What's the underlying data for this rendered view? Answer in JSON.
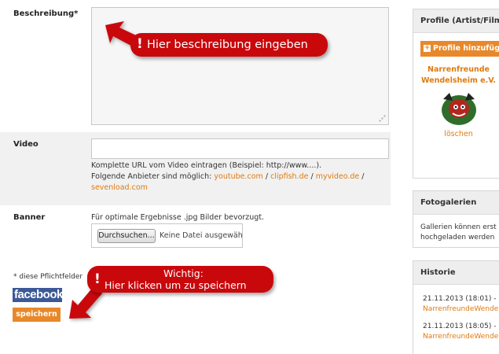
{
  "form": {
    "beschreibung_label": "Beschreibung*",
    "video_label": "Video",
    "video_help_line1": "Komplette URL vom Video eintragen (Beispiel: http://www....).",
    "providers_prefix": "Folgende Anbieter sind möglich:",
    "providers": [
      "youtube.com",
      "clipfish.de",
      "myvideo.de",
      "sevenload.com"
    ],
    "provider_separator": " / ",
    "banner_label": "Banner",
    "banner_help": "Für optimale Ergebnisse .jpg Bilder bevorzugt.",
    "file_button": "Durchsuchen...",
    "file_status": "Keine Datei ausgewählt",
    "required_note": "* diese Pflichtfelder",
    "facebook": "facebook",
    "save_button": "speichern"
  },
  "callouts": {
    "description_bang": "!",
    "description_text": "Hier beschreibung eingeben",
    "save_bang": "!",
    "save_line1": "Wichtig:",
    "save_line2": "Hier klicken um zu speichern"
  },
  "sidebar": {
    "profile_title": "Profile (Artist/Film",
    "add_profile_plus": "+",
    "add_profile": "Profile hinzufüg",
    "profile_name_line1": "Narrenfreunde",
    "profile_name_line2": "Wendelsheim e.V.",
    "delete": "löschen",
    "gallery_title": "Fotogalerien",
    "gallery_text_line1": "Gallerien können erst",
    "gallery_text_line2": "hochgeladen werden",
    "history_title": "Historie",
    "history": [
      {
        "date": "21.11.2013 (18:01) -",
        "name": "NarrenfreundeWende"
      },
      {
        "date": "21.11.2013 (18:05) -",
        "name": "NarrenfreundeWende"
      }
    ]
  },
  "colors": {
    "accent_orange": "#e8882a",
    "link_orange": "#e07a10",
    "callout_red": "#c9080c",
    "facebook_blue": "#3b5998"
  }
}
